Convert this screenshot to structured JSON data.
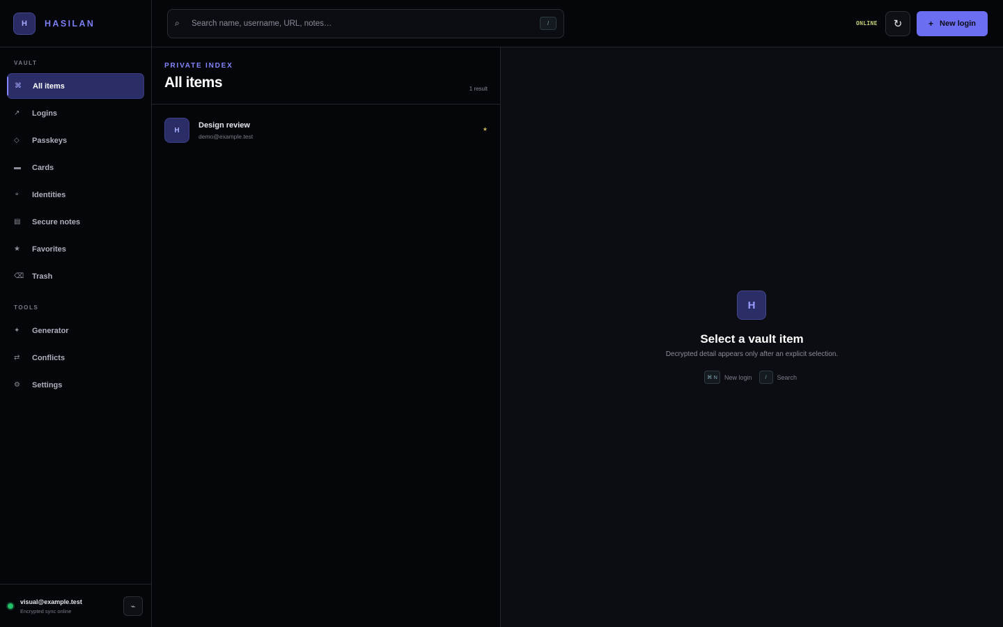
{
  "brand": {
    "logo_letter": "H",
    "name": "HASILAN"
  },
  "sidebar": {
    "vault_label": "VAULT",
    "vault_items": [
      {
        "label": "All items",
        "icon": "⌘",
        "icon_name": "command-icon",
        "active": true
      },
      {
        "label": "Logins",
        "icon": "↗",
        "icon_name": "arrow-up-right-icon"
      },
      {
        "label": "Passkeys",
        "icon": "◇",
        "icon_name": "diamond-icon"
      },
      {
        "label": "Cards",
        "icon": "▬",
        "icon_name": "card-icon"
      },
      {
        "label": "Identities",
        "icon": "⚬",
        "icon_name": "person-icon"
      },
      {
        "label": "Secure notes",
        "icon": "▤",
        "icon_name": "note-icon"
      },
      {
        "label": "Favorites",
        "icon": "★",
        "icon_name": "star-icon"
      },
      {
        "label": "Trash",
        "icon": "⌫",
        "icon_name": "trash-icon"
      }
    ],
    "tools_label": "TOOLS",
    "tool_items": [
      {
        "label": "Generator",
        "icon": "✦",
        "icon_name": "sparkle-icon"
      },
      {
        "label": "Conflicts",
        "icon": "⇄",
        "icon_name": "swap-icon"
      },
      {
        "label": "Settings",
        "icon": "⚙",
        "icon_name": "gear-icon"
      }
    ]
  },
  "account": {
    "email": "visual@example.test",
    "status": "Encrypted sync online",
    "lock_icon": "⌁"
  },
  "topbar": {
    "search_placeholder": "Search name, username, URL, notes…",
    "search_shortcut": "/",
    "status": "ONLINE",
    "refresh_icon": "↻",
    "new_login_icon": "+",
    "new_login_label": "New login"
  },
  "list": {
    "kicker": "PRIVATE INDEX",
    "title": "All items",
    "result_count": "1 result",
    "items": [
      {
        "avatar": "H",
        "title": "Design review",
        "subtitle": "demo@example.test",
        "star": "★"
      }
    ]
  },
  "detail": {
    "logo_letter": "H",
    "title": "Select a vault item",
    "subtitle": "Decrypted detail appears only after an explicit selection.",
    "hints": [
      {
        "key": "⌘ N",
        "label": "New login"
      },
      {
        "key": "/",
        "label": "Search"
      }
    ]
  },
  "colors": {
    "accent": "#6b6ef0",
    "accent_light": "#8487ff",
    "online": "#c8d27a",
    "status_green": "#22c06a"
  }
}
